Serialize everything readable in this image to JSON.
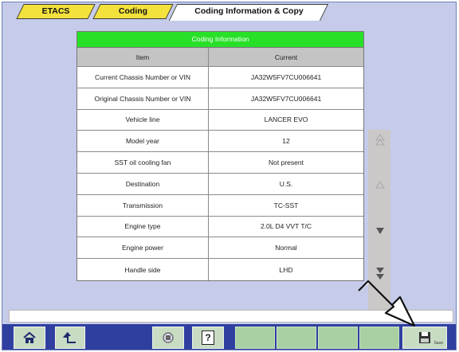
{
  "tabs": [
    {
      "label": "ETACS"
    },
    {
      "label": "Coding"
    },
    {
      "label": "Coding Information & Copy"
    }
  ],
  "coding": {
    "title": "Coding Information",
    "columns": {
      "item": "Item",
      "current": "Current"
    },
    "rows": [
      {
        "item": "Current Chassis Number or VIN",
        "current": "JA32W5FV7CU006641"
      },
      {
        "item": "Original Chassis Number or VIN",
        "current": "JA32W5FV7CU006641"
      },
      {
        "item": "Vehicle line",
        "current": "LANCER EVO"
      },
      {
        "item": "Model year",
        "current": "12"
      },
      {
        "item": "SST oil cooling fan",
        "current": "Not present"
      },
      {
        "item": "Destination",
        "current": "U.S."
      },
      {
        "item": "Transmission",
        "current": "TC-SST"
      },
      {
        "item": "Engine type",
        "current": "2.0L D4 VVT T/C"
      },
      {
        "item": "Engine power",
        "current": "Normal"
      },
      {
        "item": "Handle side",
        "current": "LHD"
      }
    ]
  },
  "toolbar": {
    "home": "home-icon",
    "back": "back-icon",
    "print": "print-icon",
    "help_label": "?",
    "save_label": "Save"
  },
  "colors": {
    "tab_yellow": "#f3e13c",
    "header_green": "#28e028",
    "toolbar_blue": "#2f3fa0",
    "frame_bg": "#c5cbe9"
  }
}
